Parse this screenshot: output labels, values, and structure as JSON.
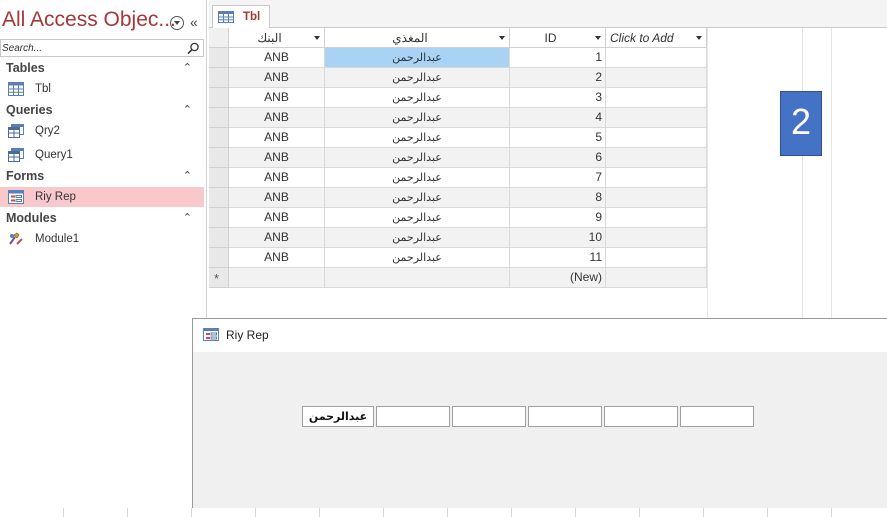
{
  "navigation": {
    "title": "All Access Objec...",
    "search_placeholder": "Search...",
    "groups": [
      {
        "label": "Tables",
        "items": [
          {
            "label": "Tbl",
            "icon": "table-icon"
          }
        ]
      },
      {
        "label": "Queries",
        "items": [
          {
            "label": "Qry2",
            "icon": "query-icon"
          },
          {
            "label": "Query1",
            "icon": "query-icon"
          }
        ]
      },
      {
        "label": "Forms",
        "items": [
          {
            "label": "Riy Rep",
            "icon": "form-icon",
            "selected": true
          }
        ]
      },
      {
        "label": "Modules",
        "items": [
          {
            "label": "Module1",
            "icon": "module-icon"
          }
        ]
      }
    ]
  },
  "document_tab": {
    "label": "Tbl"
  },
  "datasheet": {
    "columns": [
      "البنك",
      "المغذي",
      "ID",
      "Click to Add"
    ],
    "rows": [
      {
        "bank": "ANB",
        "name": "عبدالرحمن",
        "id": "1"
      },
      {
        "bank": "ANB",
        "name": "عبدالرحمن",
        "id": "2"
      },
      {
        "bank": "ANB",
        "name": "عبدالرحمن",
        "id": "3"
      },
      {
        "bank": "ANB",
        "name": "عبدالرحمن",
        "id": "4"
      },
      {
        "bank": "ANB",
        "name": "عبدالرحمن",
        "id": "5"
      },
      {
        "bank": "ANB",
        "name": "عبدالرحمن",
        "id": "6"
      },
      {
        "bank": "ANB",
        "name": "عبدالرحمن",
        "id": "7"
      },
      {
        "bank": "ANB",
        "name": "عبدالرحمن",
        "id": "8"
      },
      {
        "bank": "ANB",
        "name": "عبدالرحمن",
        "id": "9"
      },
      {
        "bank": "ANB",
        "name": "عبدالرحمن",
        "id": "10"
      },
      {
        "bank": "ANB",
        "name": "عبدالرحمن",
        "id": "11"
      }
    ],
    "new_row_mark": "*",
    "new_row_label": "(New)"
  },
  "badge": {
    "text": "2",
    "color": "#4472c4"
  },
  "form_window": {
    "title": "Riy Rep",
    "name_value": "عبدالرحمن"
  },
  "colors": {
    "accent": "#a4373a",
    "selection": "#a9d3f5",
    "nav_selected": "#f8c8cb"
  }
}
